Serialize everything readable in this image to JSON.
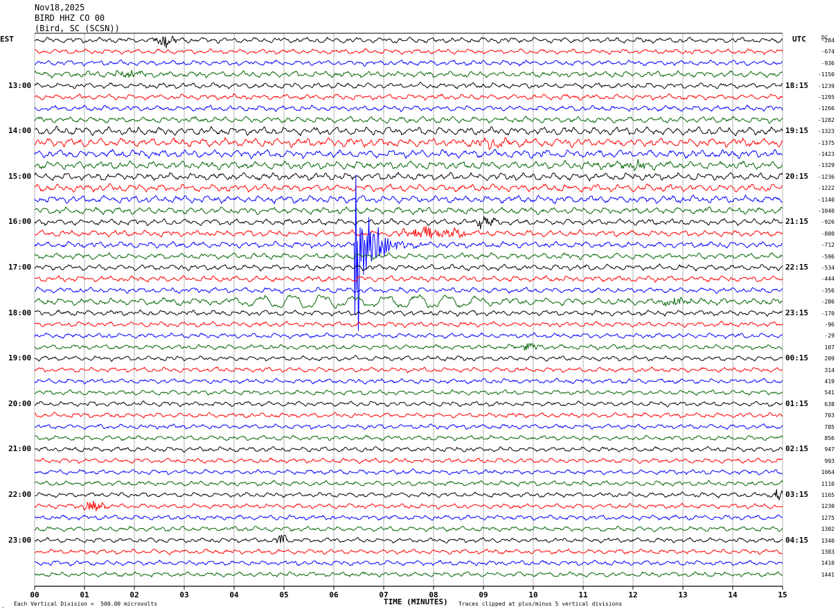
{
  "header": {
    "date": "Nov18,2025",
    "station": "BIRD HHZ CO 00",
    "location": "(Bird, SC (SCSN))"
  },
  "left_timezone": "EST",
  "right_timezone": "UTC",
  "dc_header": "DC",
  "footer": {
    "scale_note": "Each Vertical Division =  500.00 microvolts",
    "clip_note": "Traces clipped at plus/minus 5 vertical divisions",
    "corner_mark": "."
  },
  "colors": {
    "trace_cycle": [
      "#000000",
      "#ff0000",
      "#0000ff",
      "#006400"
    ],
    "grid": "#a0a0a0",
    "background": "#ffffff"
  },
  "chart_data": {
    "type": "line",
    "chart_kind": "helicorder seismogram",
    "xlabel": "TIME (MINUTES)",
    "xlim": [
      0,
      15
    ],
    "x_ticks": [
      "00",
      "01",
      "02",
      "03",
      "04",
      "05",
      "06",
      "07",
      "08",
      "09",
      "10",
      "11",
      "12",
      "13",
      "14",
      "15"
    ],
    "trace_count": 48,
    "minutes_per_trace": 15,
    "left_hour_labels": [
      {
        "row": 4,
        "label": "13:00"
      },
      {
        "row": 8,
        "label": "14:00"
      },
      {
        "row": 12,
        "label": "15:00"
      },
      {
        "row": 16,
        "label": "16:00"
      },
      {
        "row": 20,
        "label": "17:00"
      },
      {
        "row": 24,
        "label": "18:00"
      },
      {
        "row": 28,
        "label": "19:00"
      },
      {
        "row": 32,
        "label": "20:00"
      },
      {
        "row": 36,
        "label": "21:00"
      },
      {
        "row": 40,
        "label": "22:00"
      },
      {
        "row": 44,
        "label": "23:00"
      }
    ],
    "right_hour_labels": [
      {
        "row": 4,
        "label": "18:15"
      },
      {
        "row": 8,
        "label": "19:15"
      },
      {
        "row": 12,
        "label": "20:15"
      },
      {
        "row": 16,
        "label": "21:15"
      },
      {
        "row": 20,
        "label": "22:15"
      },
      {
        "row": 24,
        "label": "23:15"
      },
      {
        "row": 28,
        "label": "00:15"
      },
      {
        "row": 32,
        "label": "01:15"
      },
      {
        "row": 36,
        "label": "02:15"
      },
      {
        "row": 40,
        "label": "03:15"
      },
      {
        "row": 44,
        "label": "04:15"
      }
    ],
    "dc_offsets": [
      "-284",
      "-674",
      "-936",
      "-1150",
      "-1239",
      "-1295",
      "-1266",
      "-1282",
      "-1323",
      "-1375",
      "-1423",
      "-1329",
      "-1236",
      "-1222",
      "-1140",
      "-1040",
      "-926",
      "-800",
      "-712",
      "-596",
      "-534",
      "-444",
      "-356",
      "-286",
      "-170",
      "-96",
      "-29",
      "107",
      "209",
      "314",
      "419",
      "541",
      "638",
      "703",
      "785",
      "856",
      "947",
      "993",
      "1064",
      "1110",
      "1165",
      "1230",
      "1275",
      "1302",
      "1340",
      "1383",
      "1410",
      "1441"
    ],
    "row_amplitude": [
      0.9,
      0.8,
      0.85,
      1.0,
      0.9,
      0.9,
      0.9,
      1.0,
      1.3,
      1.4,
      1.3,
      1.3,
      1.2,
      1.2,
      1.2,
      1.1,
      1.0,
      1.0,
      1.0,
      1.0,
      0.95,
      0.95,
      0.9,
      1.1,
      0.9,
      0.85,
      0.8,
      0.8,
      0.8,
      0.8,
      0.8,
      0.8,
      0.8,
      0.8,
      0.8,
      0.8,
      0.8,
      0.8,
      0.8,
      0.8,
      0.8,
      0.8,
      0.8,
      0.8,
      0.8,
      0.8,
      0.8,
      0.8
    ],
    "events": [
      {
        "row": 0,
        "minute": 2.4,
        "duration_min": 0.5,
        "amplitude": 3.0,
        "kind": "burst"
      },
      {
        "row": 3,
        "minute": 1.6,
        "duration_min": 0.8,
        "amplitude": 1.6,
        "kind": "burst"
      },
      {
        "row": 9,
        "minute": 8.8,
        "duration_min": 0.9,
        "amplitude": 1.8,
        "kind": "burst"
      },
      {
        "row": 11,
        "minute": 11.7,
        "duration_min": 0.8,
        "amplitude": 1.6,
        "kind": "burst"
      },
      {
        "row": 16,
        "minute": 8.8,
        "duration_min": 0.5,
        "amplitude": 2.6,
        "kind": "burst"
      },
      {
        "row": 17,
        "minute": 7.1,
        "duration_min": 1.8,
        "amplitude": 2.2,
        "kind": "burst"
      },
      {
        "row": 18,
        "minute": 6.4,
        "duration_min": 1.6,
        "amplitude": 8.5,
        "kind": "quake"
      },
      {
        "row": 23,
        "minute": 2.0,
        "duration_min": 9.0,
        "amplitude": 1.7,
        "kind": "longperiod"
      },
      {
        "row": 23,
        "minute": 12.5,
        "duration_min": 0.8,
        "amplitude": 1.8,
        "kind": "burst"
      },
      {
        "row": 27,
        "minute": 9.6,
        "duration_min": 0.6,
        "amplitude": 1.8,
        "kind": "burst"
      },
      {
        "row": 40,
        "minute": 14.8,
        "duration_min": 0.3,
        "amplitude": 2.5,
        "kind": "burst"
      },
      {
        "row": 41,
        "minute": 0.9,
        "duration_min": 0.6,
        "amplitude": 2.2,
        "kind": "burst"
      },
      {
        "row": 44,
        "minute": 4.85,
        "duration_min": 0.25,
        "amplitude": 2.4,
        "kind": "burst"
      }
    ]
  }
}
